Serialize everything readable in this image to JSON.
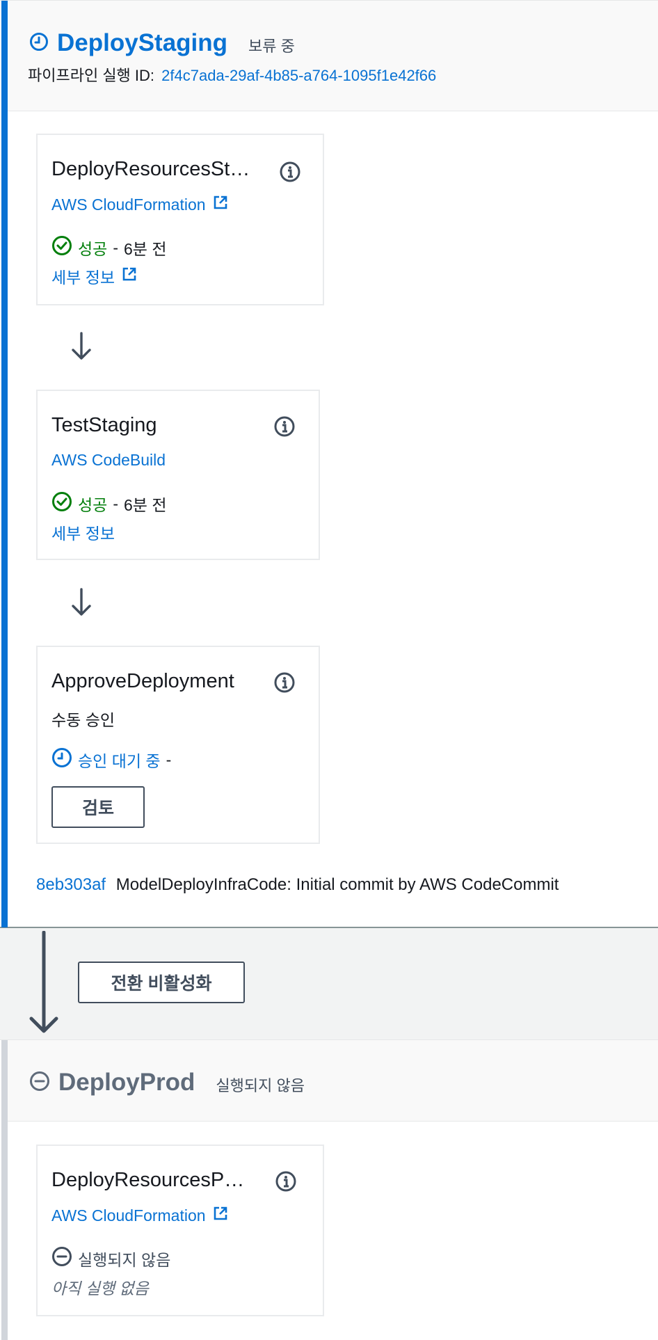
{
  "staging": {
    "title": "DeployStaging",
    "status": "보류 중",
    "exec_label": "파이프라인 실행 ID:",
    "exec_id": "2f4c7ada-29af-4b85-a764-1095f1e42f66",
    "actions": [
      {
        "name": "DeployResourcesSt…",
        "provider": "AWS CloudFormation",
        "status": "성공",
        "time": "6분 전",
        "details": "세부 정보"
      },
      {
        "name": "TestStaging",
        "provider": "AWS CodeBuild",
        "status": "성공",
        "time": "6분 전",
        "details": "세부 정보"
      },
      {
        "name": "ApproveDeployment",
        "provider": "수동 승인",
        "status": "승인 대기 중",
        "time": "-",
        "button": "검토"
      }
    ],
    "commit": {
      "hash": "8eb303af",
      "message": "ModelDeployInfraCode: Initial commit by AWS CodeCommit"
    }
  },
  "transition": {
    "button": "전환 비활성화"
  },
  "prod": {
    "title": "DeployProd",
    "status": "실행되지 않음",
    "actions": [
      {
        "name": "DeployResourcesP…",
        "provider": "AWS CloudFormation",
        "status": "실행되지 않음",
        "note": "아직 실행 없음"
      }
    ]
  },
  "colors": {
    "link": "#0972d3",
    "success": "#037f0c",
    "muted": "#5f6b7a",
    "accent": "#0972d3"
  }
}
